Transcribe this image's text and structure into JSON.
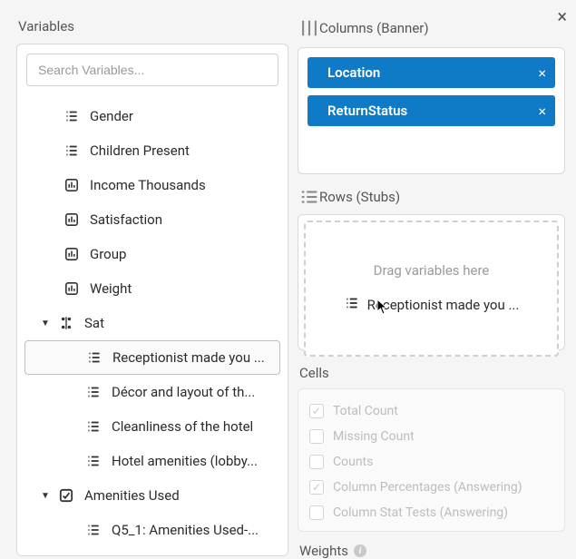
{
  "left": {
    "title": "Variables",
    "search_placeholder": "Search Variables...",
    "items": [
      {
        "icon": "list",
        "label": "Gender",
        "indent": 1
      },
      {
        "icon": "list",
        "label": "Children Present",
        "indent": 1
      },
      {
        "icon": "bar",
        "label": "Income Thousands",
        "indent": 1
      },
      {
        "icon": "bar",
        "label": "Satisfaction",
        "indent": 1
      },
      {
        "icon": "bar",
        "label": "Group",
        "indent": 1
      },
      {
        "icon": "bar",
        "label": "Weight",
        "indent": 1
      },
      {
        "icon": "multi",
        "label": "Sat",
        "indent": 0,
        "group": true,
        "expanded": true
      },
      {
        "icon": "list",
        "label": "Receptionist made you ...",
        "indent": 2,
        "selected": true
      },
      {
        "icon": "list",
        "label": "Décor and layout of th...",
        "indent": 2
      },
      {
        "icon": "list",
        "label": "Cleanliness of the hotel",
        "indent": 2
      },
      {
        "icon": "list",
        "label": "Hotel amenities (lobby...",
        "indent": 2
      },
      {
        "icon": "check",
        "label": "Amenities Used",
        "indent": 0,
        "group": true,
        "expanded": true
      },
      {
        "icon": "list",
        "label": "Q5_1: Amenities Used-...",
        "indent": 2
      }
    ]
  },
  "columns": {
    "title": "Columns (Banner)",
    "chips": [
      {
        "label": "Location"
      },
      {
        "label": "ReturnStatus"
      }
    ]
  },
  "rows": {
    "title": "Rows (Stubs)",
    "hint": "Drag variables here",
    "ghost_label": "Receptionist made you ..."
  },
  "cells": {
    "title": "Cells",
    "options": [
      {
        "label": "Total Count",
        "checked": true
      },
      {
        "label": "Missing Count",
        "checked": false
      },
      {
        "label": "Counts",
        "checked": false
      },
      {
        "label": "Column Percentages (Answering)",
        "checked": true
      },
      {
        "label": "Column Stat Tests (Answering)",
        "checked": false
      }
    ]
  },
  "weights": {
    "title": "Weights"
  }
}
